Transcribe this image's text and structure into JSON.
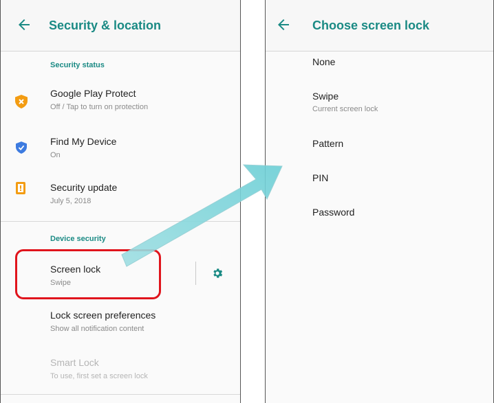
{
  "left": {
    "title": "Security & location",
    "security_status_header": "Security status",
    "items": [
      {
        "title": "Google Play Protect",
        "subtitle": "Off / Tap to turn on protection",
        "icon": "shield-alert-icon",
        "color": "#f39c12"
      },
      {
        "title": "Find My Device",
        "subtitle": "On",
        "icon": "shield-check-icon",
        "color": "#3d7be0"
      },
      {
        "title": "Security update",
        "subtitle": "July 5, 2018",
        "icon": "security-update-icon",
        "color": "#f39c12"
      }
    ],
    "device_security_header": "Device security",
    "screen_lock": {
      "title": "Screen lock",
      "subtitle": "Swipe",
      "icon": "gear-icon"
    },
    "lock_screen_prefs": {
      "title": "Lock screen preferences",
      "subtitle": "Show all notification content"
    },
    "smart_lock": {
      "title": "Smart Lock",
      "subtitle": "To use, first set a screen lock"
    }
  },
  "right": {
    "title": "Choose screen lock",
    "options": [
      {
        "title": "None",
        "subtitle": ""
      },
      {
        "title": "Swipe",
        "subtitle": "Current screen lock"
      },
      {
        "title": "Pattern",
        "subtitle": ""
      },
      {
        "title": "PIN",
        "subtitle": ""
      },
      {
        "title": "Password",
        "subtitle": ""
      }
    ]
  },
  "colors": {
    "accent": "#1a8a84",
    "highlight": "#e0141c",
    "arrow": "#7fd3d8"
  }
}
